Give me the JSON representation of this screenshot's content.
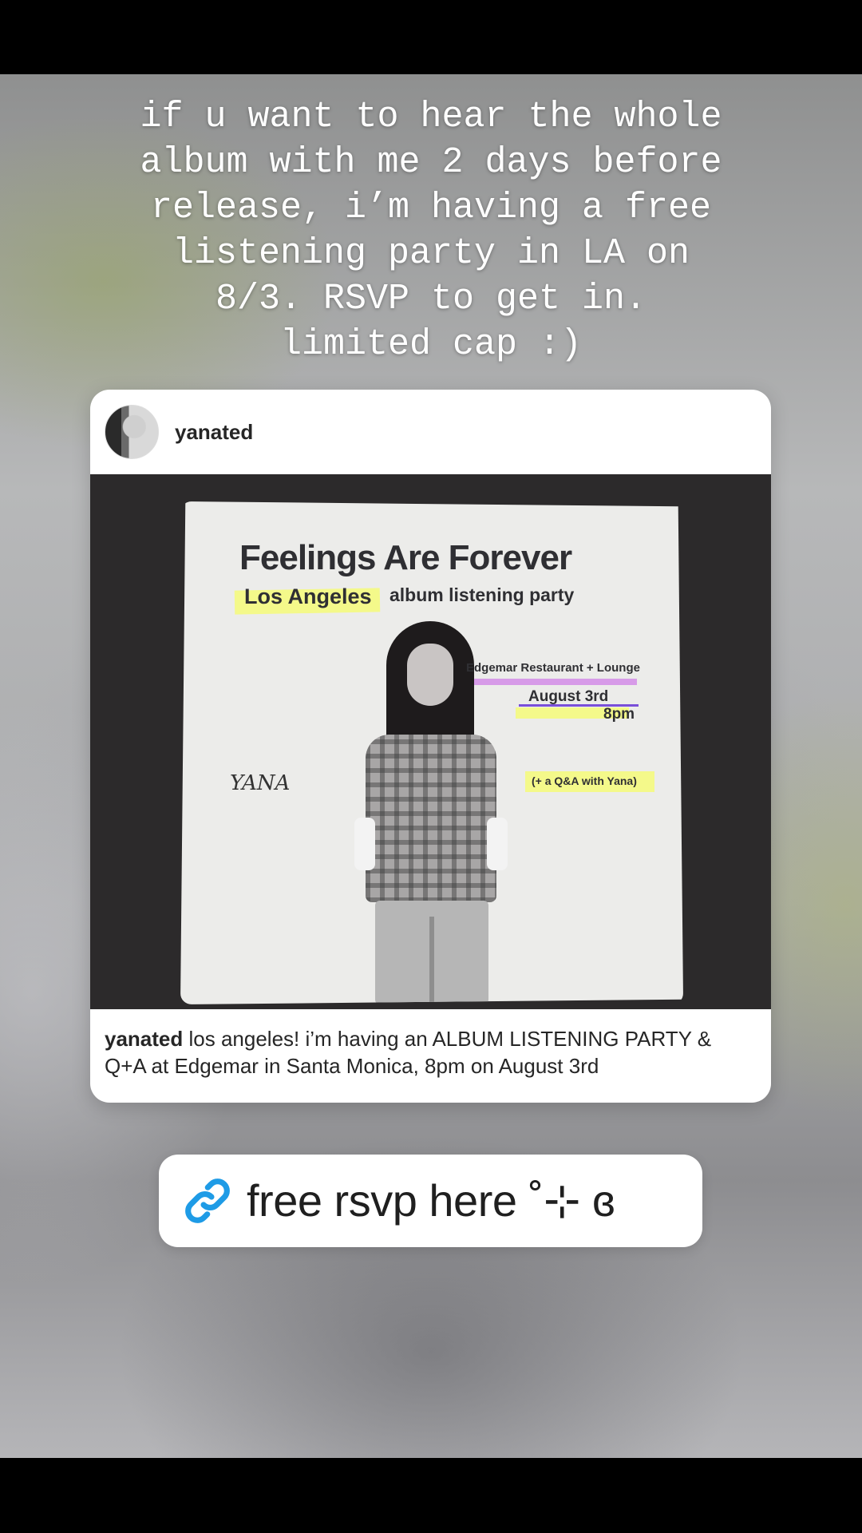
{
  "story": {
    "caption": "if u want to hear the whole\nalbum with me 2 days before\nrelease, i’m having a free\nlistening party in LA on\n8/3. RSVP to get in.\nlimited cap :)"
  },
  "post": {
    "username": "yanated",
    "caption_user": "yanated",
    "caption_text": " los angeles! i’m having an ALBUM LISTENING PARTY & Q+A at Edgemar in Santa Monica, 8pm on August 3rd",
    "poster": {
      "title": "Feelings Are Forever",
      "city": "Los Angeles",
      "subtitle": "album listening party",
      "venue": "Edgemar Restaurant + Lounge",
      "date": "August 3rd",
      "time": "8pm",
      "qa": "(+ a Q&A with Yana)",
      "signature": "YANA"
    }
  },
  "link_sticker": {
    "label": "free rsvp here ˚⊹ ɞ",
    "icon": "link-icon"
  },
  "colors": {
    "link_blue": "#1e9be6",
    "highlight_yellow": "#f4f98a",
    "highlight_pink": "#d79be8"
  }
}
